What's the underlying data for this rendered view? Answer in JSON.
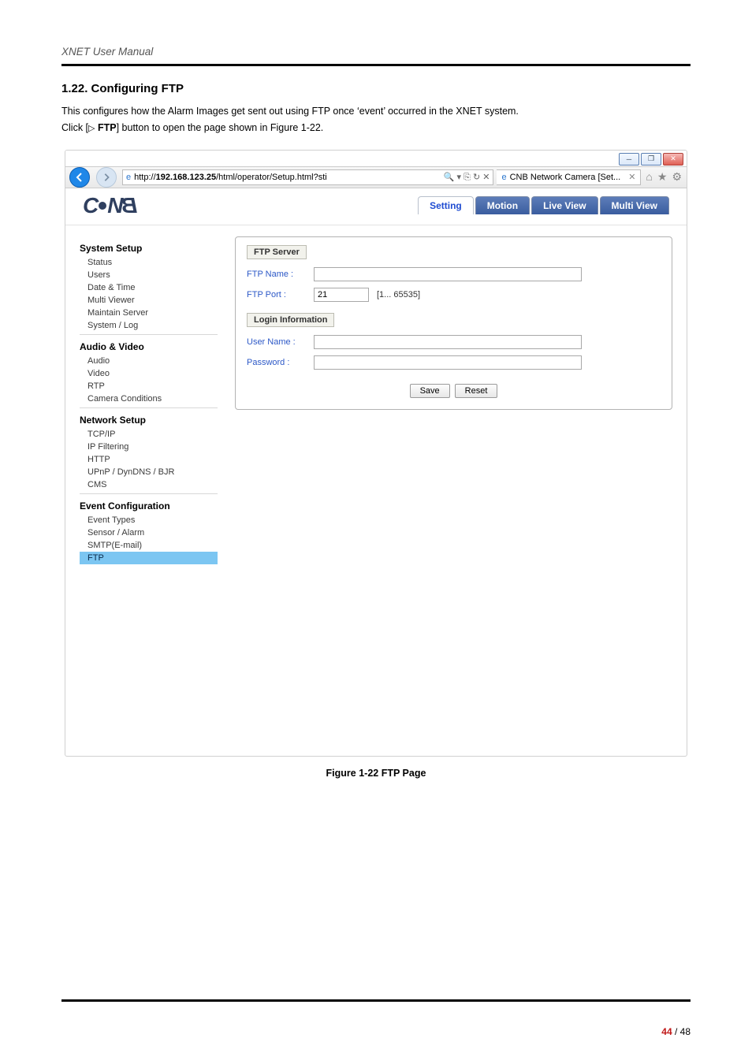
{
  "doc": {
    "running_header": "XNET User Manual",
    "section_number": "1.22. Configuring FTP",
    "para1": "This configures how the Alarm Images get sent out using FTP once ‘event’ occurred in the XNET system.",
    "para2_pre": "Click [",
    "para2_tri": "▷",
    "para2_bold": " FTP",
    "para2_post": "] button to open the page shown in Figure 1-22.",
    "figure_caption": "Figure 1-22 FTP Page",
    "page_current": "44",
    "page_sep": " / ",
    "page_total": "48"
  },
  "browser": {
    "url_prefix": "http://",
    "url_host": "192.168.123.25",
    "url_path": "/html/operator/Setup.html?sti",
    "url_suffix_glyphs": " 🔍 ▾  ⎘ ↻ ✕",
    "tab_title": "CNB Network Camera [Set...",
    "tab_close": "✕",
    "win_min": "─",
    "win_max": "❐",
    "win_close": "✕"
  },
  "app": {
    "logo_text_left": "C",
    "logo_text_mid": "N",
    "logo_text_right": "B",
    "tabs": {
      "setting": "Setting",
      "motion": "Motion",
      "live": "Live View",
      "multi": "Multi View"
    }
  },
  "nav": {
    "g1": "System Setup",
    "g1_items": [
      "Status",
      "Users",
      "Date & Time",
      "Multi Viewer",
      "Maintain Server",
      "System / Log"
    ],
    "g2": "Audio & Video",
    "g2_items": [
      "Audio",
      "Video",
      "RTP",
      "Camera Conditions"
    ],
    "g3": "Network Setup",
    "g3_items": [
      "TCP/IP",
      "IP Filtering",
      "HTTP",
      "UPnP / DynDNS / BJR",
      "CMS"
    ],
    "g4": "Event Configuration",
    "g4_items": [
      "Event Types",
      "Sensor / Alarm",
      "SMTP(E-mail)",
      "FTP"
    ]
  },
  "form": {
    "legend_server": "FTP Server",
    "ftp_name_label": "FTP Name :",
    "ftp_name_value": "",
    "ftp_port_label": "FTP Port :",
    "ftp_port_value": "21",
    "ftp_port_hint": "[1... 65535]",
    "legend_login": "Login Information",
    "user_label": "User Name :",
    "user_value": "",
    "pass_label": "Password :",
    "pass_value": "",
    "save": "Save",
    "reset": "Reset"
  }
}
